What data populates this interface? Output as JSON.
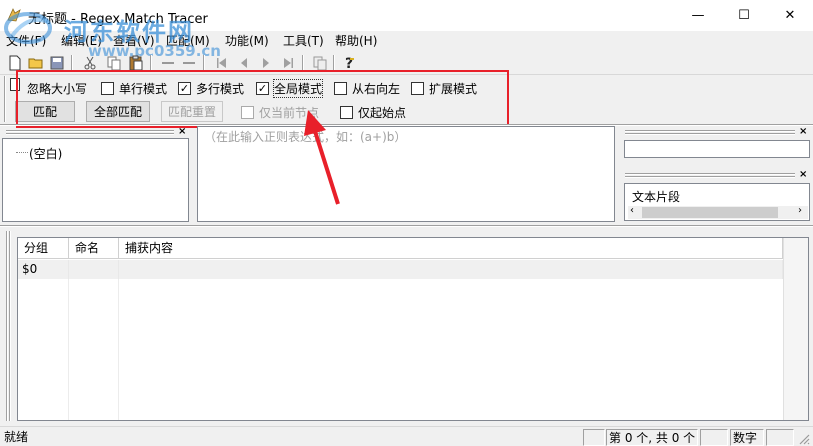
{
  "window": {
    "title": "无标题 - Regex Match Tracer",
    "minimize_glyph": "—",
    "maximize_glyph": "☐",
    "close_glyph": "✕"
  },
  "watermark": {
    "text": "河东软件网",
    "url": "www.pc0359.cn"
  },
  "menu": [
    {
      "label": "文件(F)"
    },
    {
      "label": "编辑(E)"
    },
    {
      "label": "查看(V)"
    },
    {
      "label": "匹配(M)"
    },
    {
      "label": "功能(M)"
    },
    {
      "label": "工具(T)"
    },
    {
      "label": "帮助(H)"
    }
  ],
  "toolbar": {
    "icons": [
      "new-file-icon",
      "open-folder-icon",
      "save-icon",
      "cut-icon",
      "copy-icon",
      "paste-icon",
      "first-icon",
      "prev-icon",
      "next-icon",
      "last-icon",
      "copy-node-icon",
      "help-icon"
    ]
  },
  "options": {
    "row1": [
      {
        "label": "忽略大小写",
        "checked": false
      },
      {
        "label": "单行模式",
        "checked": false
      },
      {
        "label": "多行模式",
        "checked": true
      },
      {
        "label": "全局模式",
        "checked": true
      },
      {
        "label": "从右向左",
        "checked": false
      },
      {
        "label": "扩展模式",
        "checked": false
      }
    ],
    "buttons": [
      {
        "label": "匹配",
        "enabled": true
      },
      {
        "label": "全部匹配",
        "enabled": true
      },
      {
        "label": "匹配重置",
        "enabled": false
      }
    ],
    "row2_checks": [
      {
        "label": "仅当前节点",
        "checked": false,
        "enabled": false
      },
      {
        "label": "仅起始点",
        "checked": false,
        "enabled": true
      }
    ]
  },
  "tree": {
    "items": [
      "(空白)"
    ]
  },
  "regex_editor": {
    "placeholder": "（在此输入正则表达式，如：(a+)b）"
  },
  "right_panel": {
    "text_fragment_label": "文本片段"
  },
  "grid": {
    "columns": [
      "分组",
      "命名",
      "捕获内容"
    ],
    "rows": [
      {
        "group": "$0",
        "name": "",
        "capture": ""
      }
    ]
  },
  "statusbar": {
    "ready": "就绪",
    "position": "第 0 个, 共 0 个",
    "num": "数字"
  },
  "colors": {
    "highlight": "#e8202a",
    "watermark": "#3a8fd8"
  }
}
